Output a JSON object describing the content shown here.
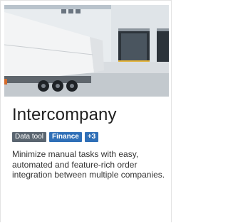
{
  "card": {
    "title": "Intercompany",
    "tags": [
      "Data tool",
      "Finance",
      "+3"
    ],
    "description": "Minimize manual tasks with easy, automated and feature-rich order integration between multiple companies."
  },
  "colors": {
    "tag_gray": "#5a6570",
    "tag_blue": "#2f6fb7",
    "title_text": "#1f1f1f"
  }
}
